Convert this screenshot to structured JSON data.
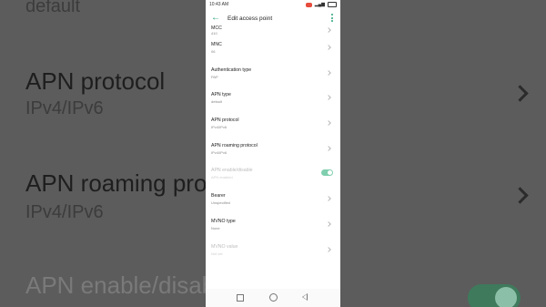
{
  "background": {
    "top_value": "default",
    "items": [
      {
        "label": "APN protocol",
        "value": "IPv4/IPv6"
      },
      {
        "label": "APN roaming prot",
        "value": "IPv4/IPv6"
      },
      {
        "label": "APN enable/disab",
        "value": ""
      }
    ]
  },
  "status_bar": {
    "time": "10:43 AM"
  },
  "app_bar": {
    "title": "Edit access point",
    "back_icon": "arrow-left-icon",
    "menu_icon": "more-vertical-icon"
  },
  "settings": [
    {
      "label": "MCC",
      "value": "410"
    },
    {
      "label": "MNC",
      "value": "06"
    },
    {
      "label": "Authentication type",
      "value": "PAP"
    },
    {
      "label": "APN type",
      "value": "default"
    },
    {
      "label": "APN protocol",
      "value": "IPv4/IPv6"
    },
    {
      "label": "APN roaming protocol",
      "value": "IPv4/IPv6"
    },
    {
      "label": "APN enable/disable",
      "value": "APN enabled",
      "toggle_on": true
    },
    {
      "label": "Bearer",
      "value": "Unspecified"
    },
    {
      "label": "MVNO type",
      "value": "None"
    },
    {
      "label": "MVNO value",
      "value": "Not set"
    }
  ],
  "colors": {
    "accent": "#2aa37a",
    "toggle_track": "#7fcfae"
  }
}
